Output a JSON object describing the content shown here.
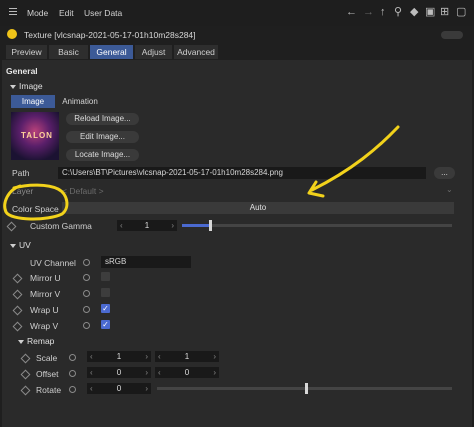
{
  "menu": {
    "mode": "Mode",
    "edit": "Edit",
    "user_data": "User Data"
  },
  "title": "Texture [vlcsnap-2021-05-17-01h10m28s284]",
  "tabs": [
    {
      "label": "Preview",
      "active": false
    },
    {
      "label": "Basic",
      "active": false
    },
    {
      "label": "General",
      "active": true
    },
    {
      "label": "Adjust",
      "active": false
    },
    {
      "label": "Advanced",
      "active": false
    }
  ],
  "general": {
    "section_title": "General",
    "image_group": "Image",
    "image_tabs": [
      "Image",
      "Animation"
    ],
    "thumbnail_text": "TALON",
    "buttons": {
      "reload": "Reload Image...",
      "edit": "Edit Image...",
      "locate": "Locate Image..."
    },
    "path_label": "Path",
    "path_value": "C:\\Users\\BT\\Pictures\\vlcsnap-2021-05-17-01h10m28s284.png",
    "path_button": "...",
    "layer_label": "Layer",
    "layer_value": "< Default >",
    "color_space_label": "Color Space",
    "color_space_value": "Auto",
    "custom_gamma_label": "Custom Gamma",
    "custom_gamma_value": "1",
    "custom_gamma_fill": 0.1
  },
  "uv": {
    "group": "UV",
    "uv_channel_label": "UV Channel",
    "uv_channel_value": "sRGB",
    "mirror_u_label": "Mirror U",
    "mirror_u": false,
    "mirror_v_label": "Mirror V",
    "mirror_v": false,
    "wrap_u_label": "Wrap U",
    "wrap_u": true,
    "wrap_v_label": "Wrap V",
    "wrap_v": true
  },
  "remap": {
    "group": "Remap",
    "scale_label": "Scale",
    "scale_x": "1",
    "scale_y": "1",
    "offset_label": "Offset",
    "offset_x": "0",
    "offset_y": "0",
    "rotate_label": "Rotate",
    "rotate_value": "0",
    "rotate_fill": 0.5
  },
  "colors": {
    "accent": "#3c5a97",
    "annotation": "#f2d21b"
  }
}
